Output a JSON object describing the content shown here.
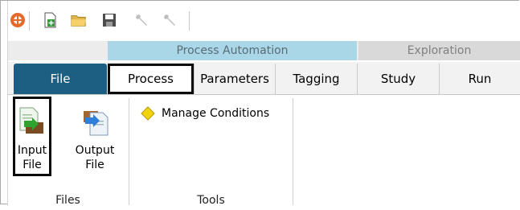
{
  "quick_access": {
    "icons": [
      "app-logo-icon",
      "new-file-icon",
      "open-folder-icon",
      "save-icon",
      "tool-icon",
      "tool-icon"
    ]
  },
  "ribbon": {
    "groups": {
      "process_automation": "Process Automation",
      "exploration": "Exploration"
    },
    "tabs": [
      {
        "label": "File"
      },
      {
        "label": "Process"
      },
      {
        "label": "Parameters"
      },
      {
        "label": "Tagging"
      },
      {
        "label": "Study"
      },
      {
        "label": "Run"
      }
    ],
    "files_group": {
      "input_file_line1": "Input",
      "input_file_line2": "File",
      "output_file_line1": "Output",
      "output_file_line2": "File",
      "label": "Files"
    },
    "tools_group": {
      "manage_conditions": "Manage Conditions",
      "label": "Tools"
    }
  },
  "colors": {
    "file_tab": "#1c5f83",
    "process_automation": "#a9d7e7",
    "exploration": "#d9d9d9",
    "manage_icon": "#f2d40c"
  }
}
